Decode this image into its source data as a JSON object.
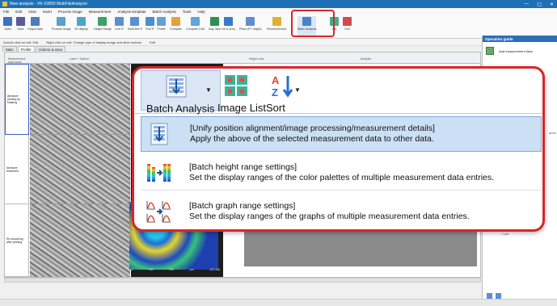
{
  "window": {
    "title": "New analysis - VK-X3000 MultiFileAnalyzer",
    "controls": [
      "—",
      "▢",
      "✕"
    ]
  },
  "menu": [
    "File",
    "Edit",
    "View",
    "Insert",
    "Process image",
    "Measurement",
    "Analysis template",
    "Batch Analysis",
    "Tools",
    "Help"
  ],
  "ribbon": {
    "buttons": [
      "Open",
      "Save",
      "Output data",
      "Process image",
      "3D display",
      "Height Range",
      "Line R",
      "Multi-line R",
      "Surf R",
      "Profile",
      "Compare",
      "Compare CAD",
      "Avg. step",
      "Vol & area",
      "Plane (Pl. height)",
      "Recommended",
      "Batch Analysis",
      "List",
      "Sort"
    ]
  },
  "hints": {
    "double_click": "Double click on cell: Edit",
    "right_click": "Right click on cell: Change type of display image and other actions",
    "edit": "Edit"
  },
  "tabs": [
    "Main",
    "Profile",
    "Volume & area"
  ],
  "grid": {
    "header_cells": [
      "Measurement data name",
      "Laser + Optical",
      "Height color",
      "Analysis"
    ],
    "rows": [
      {
        "label": "Abrasive peeling by blasting"
      },
      {
        "label": "Abrasive treatment"
      },
      {
        "label": "Re-anodizing after peeling"
      }
    ],
    "colormap_axis": [
      "0",
      "100",
      "200",
      "μm",
      "202.348"
    ]
  },
  "guide": {
    "title": "Operation guide",
    "item": "Add measurement data.",
    "side_label": "ance",
    "tree_items": [
      "□  μm",
      "□  μm"
    ]
  },
  "popup": {
    "buttons": {
      "batch_analysis": "Batch Analysis",
      "image_list": "Image List",
      "sort": "Sort"
    },
    "items": [
      {
        "title": "[Unify position alignment/image processing/measurement details]",
        "desc": "Apply the above of the selected measurement data to other data."
      },
      {
        "title": "[Batch height range settings]",
        "desc": "Set the display ranges of the color palettes of multiple measurement data entries."
      },
      {
        "title": "[Batch graph range settings]",
        "desc": "Set the display ranges of the graphs of multiple measurement data entries."
      }
    ]
  },
  "colors": {
    "accent_red": "#d9252b",
    "selection_blue": "#cce0f5",
    "titlebar_blue": "#1f6fb5"
  }
}
